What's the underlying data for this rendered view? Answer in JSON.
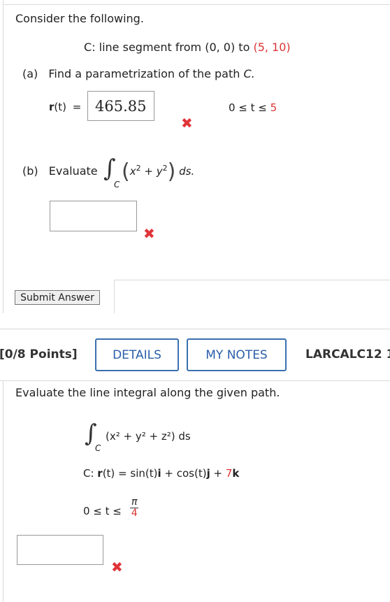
{
  "problem1": {
    "intro": "Consider the following.",
    "c_line_prefix": "C: line segment from (0, 0) to ",
    "c_point": "(5, 10)",
    "part_a_label": "(a)",
    "part_a_text": "Find a parametrization of the path",
    "part_a_C": "C.",
    "r_label": "r",
    "r_arg": "(t)",
    "equals": "=",
    "answer_a": "465.85",
    "t_range_prefix": "0 ≤ t ≤ ",
    "t_range_max": "5",
    "part_b_label": "(b)",
    "part_b_text": "Evaluate",
    "integral_sub": "C",
    "integrand_open": "(",
    "integrand_x": "x",
    "integrand_plus": " + ",
    "integrand_y": "y",
    "exp2": "2",
    "integrand_close": ")",
    "ds": "ds.",
    "answer_b": ""
  },
  "submit_label": "Submit Answer",
  "problem2": {
    "points": "[0/8 Points]",
    "details_label": "DETAILS",
    "mynotes_label": "MY NOTES",
    "course": "LARCALC12 1",
    "instruction": "Evaluate the line integral along the given path.",
    "integral_sub": "C",
    "integrand": "(x² + y² + z²) ds",
    "c_prefix": "C: ",
    "r_bold": "r",
    "r_def_mid": "(t) = sin(t)",
    "i": "i",
    "r_def_mid2": " + cos(t)",
    "j": "j",
    "plus": " + ",
    "seven": "7",
    "k": "k",
    "range_prefix": "0 ≤ t ≤",
    "pi": "π",
    "four": "4",
    "answer": ""
  }
}
